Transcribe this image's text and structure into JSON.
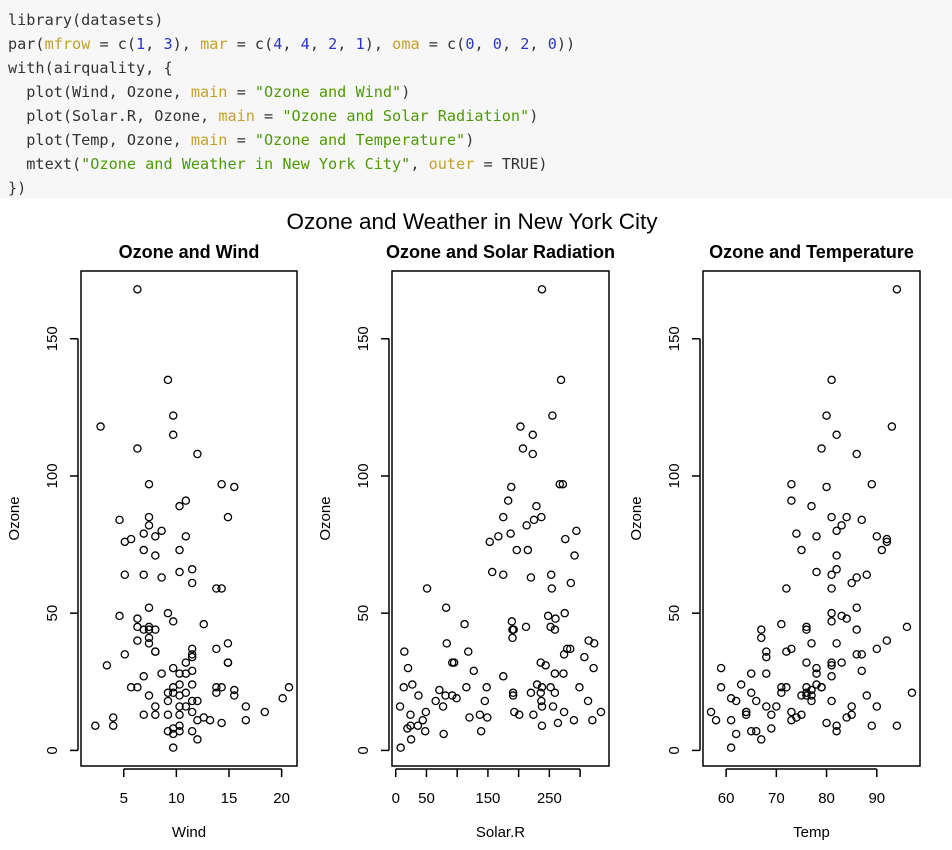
{
  "code": {
    "lines": [
      [
        {
          "t": "library(datasets)",
          "c": ""
        }
      ],
      [
        {
          "t": "par(",
          "c": ""
        },
        {
          "t": "mfrow",
          "c": "kw"
        },
        {
          "t": " = c(",
          "c": ""
        },
        {
          "t": "1",
          "c": "num"
        },
        {
          "t": ", ",
          "c": ""
        },
        {
          "t": "3",
          "c": "num"
        },
        {
          "t": "), ",
          "c": ""
        },
        {
          "t": "mar",
          "c": "kw"
        },
        {
          "t": " = c(",
          "c": ""
        },
        {
          "t": "4",
          "c": "num"
        },
        {
          "t": ", ",
          "c": ""
        },
        {
          "t": "4",
          "c": "num"
        },
        {
          "t": ", ",
          "c": ""
        },
        {
          "t": "2",
          "c": "num"
        },
        {
          "t": ", ",
          "c": ""
        },
        {
          "t": "1",
          "c": "num"
        },
        {
          "t": "), ",
          "c": ""
        },
        {
          "t": "oma",
          "c": "kw"
        },
        {
          "t": " = c(",
          "c": ""
        },
        {
          "t": "0",
          "c": "num"
        },
        {
          "t": ", ",
          "c": ""
        },
        {
          "t": "0",
          "c": "num"
        },
        {
          "t": ", ",
          "c": ""
        },
        {
          "t": "2",
          "c": "num"
        },
        {
          "t": ", ",
          "c": ""
        },
        {
          "t": "0",
          "c": "num"
        },
        {
          "t": "))",
          "c": ""
        }
      ],
      [
        {
          "t": "with(airquality, {",
          "c": ""
        }
      ],
      [
        {
          "t": "  plot(Wind, Ozone, ",
          "c": ""
        },
        {
          "t": "main",
          "c": "kw"
        },
        {
          "t": " = ",
          "c": ""
        },
        {
          "t": "\"Ozone and Wind\"",
          "c": "str"
        },
        {
          "t": ")",
          "c": ""
        }
      ],
      [
        {
          "t": "  plot(Solar.R, Ozone, ",
          "c": ""
        },
        {
          "t": "main",
          "c": "kw"
        },
        {
          "t": " = ",
          "c": ""
        },
        {
          "t": "\"Ozone and Solar Radiation\"",
          "c": "str"
        },
        {
          "t": ")",
          "c": ""
        }
      ],
      [
        {
          "t": "  plot(Temp, Ozone, ",
          "c": ""
        },
        {
          "t": "main",
          "c": "kw"
        },
        {
          "t": " = ",
          "c": ""
        },
        {
          "t": "\"Ozone and Temperature\"",
          "c": "str"
        },
        {
          "t": ")",
          "c": ""
        }
      ],
      [
        {
          "t": "  mtext(",
          "c": ""
        },
        {
          "t": "\"Ozone and Weather in New York City\"",
          "c": "str"
        },
        {
          "t": ", ",
          "c": ""
        },
        {
          "t": "outer",
          "c": "kw"
        },
        {
          "t": " = TRUE)",
          "c": ""
        }
      ],
      [
        {
          "t": "})",
          "c": ""
        }
      ]
    ]
  },
  "chart_data": {
    "outer_title": "Ozone and Weather in New York City",
    "panels": [
      {
        "type": "scatter",
        "title": "Ozone and Wind",
        "xlabel": "Wind",
        "ylabel": "Ozone",
        "xlim": [
          1.7,
          20.7
        ],
        "ylim": [
          1,
          168
        ],
        "xticks": [
          5,
          10,
          15,
          20
        ],
        "xtick_labels": [
          "5",
          "10",
          "15",
          "20"
        ],
        "yticks": [
          0,
          50,
          100,
          150
        ],
        "ytick_labels": [
          "0",
          "50",
          "100",
          "150"
        ],
        "x": [
          7.4,
          8,
          12.6,
          11.5,
          8.6,
          13.8,
          20.1,
          9.7,
          9.2,
          10.9,
          13.2,
          11.5,
          12,
          18.4,
          11.5,
          9.7,
          9.7,
          16.6,
          9.7,
          12,
          12,
          14.9,
          5.7,
          7.4,
          9.7,
          13.8,
          11.5,
          8,
          14.9,
          20.7,
          9.2,
          11.5,
          10.3,
          4,
          9.2,
          9.2,
          4.6,
          10.9,
          5.1,
          6.3,
          5.7,
          7.4,
          14.3,
          14.9,
          14.3,
          6.9,
          10.3,
          6.3,
          5.1,
          11.5,
          6.9,
          8.6,
          8,
          8.6,
          12,
          7.4,
          7.4,
          7.4,
          9.2,
          6.9,
          13.8,
          7.4,
          4,
          10.3,
          8,
          11.5,
          11.5,
          9.7,
          10.3,
          6.3,
          7.4,
          10.9,
          10.3,
          15.5,
          14.3,
          9.7,
          3.4,
          8,
          9.7,
          2.3,
          6.3,
          6.3,
          6.9,
          5.1,
          2.8,
          4.6,
          7.4,
          15.5,
          10.9,
          10.3,
          10.9,
          9.7,
          14.9,
          15.5,
          6.3,
          10.9,
          11.5,
          6.9,
          13.8,
          10.3,
          10.3,
          8,
          12.6,
          9.2,
          10.3,
          10.3,
          16.6,
          6.9,
          14.3,
          8,
          11.5
        ],
        "y": [
          41,
          36,
          12,
          18,
          28,
          23,
          19,
          8,
          7,
          16,
          11,
          14,
          18,
          14,
          34,
          6,
          30,
          11,
          1,
          11,
          4,
          32,
          23,
          45,
          115,
          37,
          29,
          71,
          39,
          23,
          21,
          37,
          20,
          12,
          13,
          135,
          49,
          32,
          64,
          40,
          77,
          97,
          97,
          85,
          10,
          27,
          7,
          48,
          35,
          61,
          79,
          63,
          16,
          80,
          108,
          20,
          52,
          82,
          50,
          64,
          59,
          39,
          9,
          16,
          78,
          35,
          66,
          122,
          89,
          110,
          44,
          28,
          65,
          22,
          59,
          23,
          31,
          44,
          21,
          9,
          45,
          168,
          73,
          76,
          118,
          84,
          85,
          96,
          78,
          73,
          91,
          47,
          32,
          20,
          23,
          21,
          24,
          44,
          21,
          28,
          9,
          13,
          46,
          18,
          13,
          24,
          16,
          13,
          23,
          36,
          7,
          14,
          30,
          14,
          18,
          20
        ]
      },
      {
        "type": "scatter",
        "title": "Ozone and Solar Radiation",
        "xlabel": "Solar.R",
        "ylabel": "Ozone",
        "xlim": [
          7,
          334
        ],
        "ylim": [
          1,
          168
        ],
        "xticks": [
          0,
          50,
          100,
          150,
          200,
          250,
          300
        ],
        "xtick_labels": [
          "0",
          "50",
          "",
          "150",
          "",
          "250",
          ""
        ],
        "yticks": [
          0,
          50,
          100,
          150
        ],
        "ytick_labels": [
          "0",
          "50",
          "100",
          "150"
        ],
        "x": [
          190,
          118,
          149,
          313,
          299,
          99,
          19,
          256,
          290,
          274,
          65,
          334,
          307,
          78,
          322,
          44,
          8,
          320,
          25,
          92,
          13,
          252,
          223,
          279,
          127,
          291,
          323,
          148,
          191,
          284,
          37,
          120,
          137,
          269,
          248,
          236,
          175,
          314,
          276,
          267,
          272,
          175,
          264,
          175,
          48,
          260,
          274,
          285,
          187,
          220,
          7,
          294,
          223,
          81,
          82,
          213,
          275,
          253,
          254,
          83,
          24,
          77,
          255,
          229,
          207,
          192,
          273,
          157,
          71,
          51,
          115,
          244,
          190,
          259,
          36,
          212,
          238,
          215,
          153,
          203,
          225,
          237,
          188,
          167,
          197,
          183,
          189,
          95,
          92,
          252,
          220,
          230,
          259,
          236,
          259,
          238,
          24,
          112,
          237,
          224,
          27,
          238,
          201,
          238,
          14,
          139,
          49,
          20,
          193,
          145,
          191,
          131,
          223
        ],
        "y": [
          41,
          36,
          12,
          18,
          23,
          19,
          8,
          16,
          11,
          14,
          18,
          14,
          34,
          6,
          30,
          11,
          1,
          11,
          4,
          32,
          23,
          45,
          115,
          37,
          29,
          71,
          39,
          23,
          21,
          37,
          20,
          12,
          13,
          135,
          49,
          32,
          64,
          40,
          77,
          97,
          97,
          85,
          10,
          27,
          7,
          48,
          35,
          61,
          79,
          63,
          16,
          80,
          108,
          20,
          52,
          82,
          50,
          64,
          59,
          39,
          9,
          16,
          122,
          89,
          110,
          44,
          28,
          65,
          22,
          59,
          23,
          31,
          44,
          21,
          9,
          45,
          168,
          73,
          76,
          118,
          84,
          85,
          96,
          78,
          73,
          91,
          47,
          32,
          20,
          23,
          21,
          24,
          44,
          21,
          28,
          9,
          13,
          46,
          18,
          13,
          24,
          16,
          13,
          23,
          36,
          7,
          14,
          30,
          14,
          18,
          20
        ]
      },
      {
        "type": "scatter",
        "title": "Ozone and Temperature",
        "xlabel": "Temp",
        "ylabel": "Ozone",
        "xlim": [
          57,
          97
        ],
        "ylim": [
          1,
          168
        ],
        "xticks": [
          60,
          70,
          80,
          90
        ],
        "xtick_labels": [
          "60",
          "70",
          "80",
          "90"
        ],
        "yticks": [
          0,
          50,
          100,
          150
        ],
        "ytick_labels": [
          "0",
          "50",
          "100",
          "150"
        ],
        "x": [
          67,
          72,
          74,
          62,
          65,
          59,
          61,
          69,
          66,
          68,
          58,
          64,
          66,
          57,
          68,
          62,
          59,
          73,
          61,
          61,
          67,
          81,
          79,
          76,
          82,
          90,
          87,
          82,
          77,
          72,
          65,
          73,
          76,
          84,
          85,
          81,
          83,
          83,
          88,
          92,
          92,
          89,
          73,
          81,
          80,
          81,
          82,
          84,
          87,
          85,
          74,
          86,
          85,
          82,
          86,
          88,
          86,
          83,
          81,
          81,
          81,
          82,
          89,
          90,
          90,
          86,
          82,
          80,
          77,
          79,
          76,
          78,
          78,
          77,
          72,
          79,
          81,
          86,
          97,
          94,
          96,
          94,
          91,
          92,
          93,
          87,
          84,
          80,
          78,
          75,
          73,
          81,
          76,
          77,
          71,
          71,
          78,
          67,
          76,
          68,
          82,
          64,
          71,
          81,
          69,
          63,
          70,
          75,
          76,
          68,
          65,
          73,
          78,
          64,
          77,
          75,
          76,
          79
        ],
        "y": [
          41,
          36,
          12,
          18,
          28,
          23,
          19,
          8,
          7,
          16,
          11,
          14,
          18,
          14,
          34,
          6,
          30,
          11,
          1,
          11,
          4,
          32,
          23,
          45,
          115,
          37,
          29,
          71,
          39,
          23,
          21,
          37,
          20,
          12,
          13,
          135,
          49,
          32,
          64,
          40,
          77,
          97,
          97,
          85,
          10,
          27,
          7,
          48,
          35,
          61,
          79,
          63,
          16,
          80,
          108,
          20,
          52,
          82,
          50,
          64,
          59,
          39,
          9,
          16,
          78,
          35,
          66,
          122,
          89,
          110,
          44,
          28,
          65,
          22,
          59,
          23,
          31,
          44,
          21,
          9,
          45,
          168,
          73,
          76,
          118,
          84,
          85,
          96,
          78,
          73,
          91,
          47,
          32,
          20,
          23,
          21,
          24,
          44,
          21,
          28,
          9,
          13,
          46,
          18,
          13,
          24,
          16,
          13,
          23,
          36,
          7,
          14,
          30,
          14,
          18,
          20
        ]
      }
    ]
  }
}
